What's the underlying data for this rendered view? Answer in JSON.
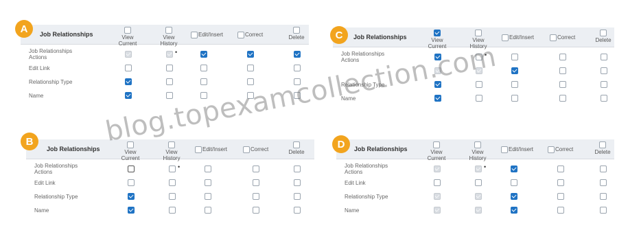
{
  "watermark": "blog.topexamcollection.com",
  "panels": [
    {
      "letter": "A",
      "title": "Job Relationships",
      "columns": [
        "View Current",
        "View History",
        "Edit/Insert",
        "Correct",
        "Delete"
      ],
      "rows": [
        {
          "label": "Job Relationships Actions",
          "cells": [
            "disabled",
            "disabled-asterisk",
            "checked",
            "checked",
            "checked"
          ]
        },
        {
          "label": "Edit Link",
          "cells": [
            "unchecked",
            "unchecked",
            "unchecked",
            "unchecked",
            "unchecked"
          ]
        },
        {
          "label": "Relationship Type",
          "cells": [
            "checked",
            "unchecked",
            "unchecked",
            "unchecked",
            "unchecked"
          ]
        },
        {
          "label": "Name",
          "cells": [
            "checked",
            "unchecked",
            "unchecked",
            "unchecked",
            "unchecked"
          ]
        }
      ]
    },
    {
      "letter": "C",
      "title": "Job Relationships",
      "columns": [
        "View Current",
        "View History",
        "Edit/Insert",
        "Correct",
        "Delete"
      ],
      "rows": [
        {
          "label": "Job Relationships Actions",
          "cells": [
            "checked",
            "unchecked-asterisk",
            "unchecked",
            "unchecked",
            "unchecked"
          ]
        },
        {
          "label": "",
          "cells": [
            "disabled",
            "disabled",
            "checked",
            "unchecked",
            "unchecked"
          ]
        },
        {
          "label": "Relationship Type",
          "cells": [
            "checked",
            "unchecked",
            "unchecked",
            "unchecked",
            "unchecked"
          ]
        },
        {
          "label": "Name",
          "cells": [
            "checked",
            "unchecked",
            "unchecked",
            "unchecked",
            "unchecked"
          ]
        }
      ]
    },
    {
      "letter": "B",
      "title": "Job Relationships",
      "columns": [
        "View Current",
        "View History",
        "Edit/Insert",
        "Correct",
        "Delete"
      ],
      "rows": [
        {
          "label": "Job Relationships Actions",
          "cells": [
            "unchecked-bold",
            "unchecked-asterisk",
            "unchecked",
            "unchecked",
            "unchecked"
          ]
        },
        {
          "label": "Edit Link",
          "cells": [
            "unchecked",
            "unchecked",
            "unchecked",
            "unchecked",
            "unchecked"
          ]
        },
        {
          "label": "Relationship Type",
          "cells": [
            "checked",
            "unchecked",
            "unchecked",
            "unchecked",
            "unchecked"
          ]
        },
        {
          "label": "Name",
          "cells": [
            "checked",
            "unchecked",
            "unchecked",
            "unchecked",
            "unchecked"
          ]
        }
      ]
    },
    {
      "letter": "D",
      "title": "Job Relationships",
      "columns": [
        "View Current",
        "View History",
        "Edit/Insert",
        "Correct",
        "Delete"
      ],
      "rows": [
        {
          "label": "Job Relationships Actions",
          "cells": [
            "disabled",
            "disabled-asterisk",
            "checked",
            "unchecked",
            "unchecked"
          ]
        },
        {
          "label": "Edit Link",
          "cells": [
            "unchecked",
            "unchecked",
            "unchecked",
            "unchecked",
            "unchecked"
          ]
        },
        {
          "label": "Relationship Type",
          "cells": [
            "disabled",
            "disabled",
            "checked",
            "unchecked",
            "unchecked"
          ]
        },
        {
          "label": "Name",
          "cells": [
            "disabled",
            "disabled",
            "checked",
            "unchecked",
            "unchecked"
          ]
        }
      ]
    }
  ],
  "colors": {
    "accent": "#1f73c4",
    "badge": "#f2a41e",
    "header_bg": "#eceff3"
  }
}
